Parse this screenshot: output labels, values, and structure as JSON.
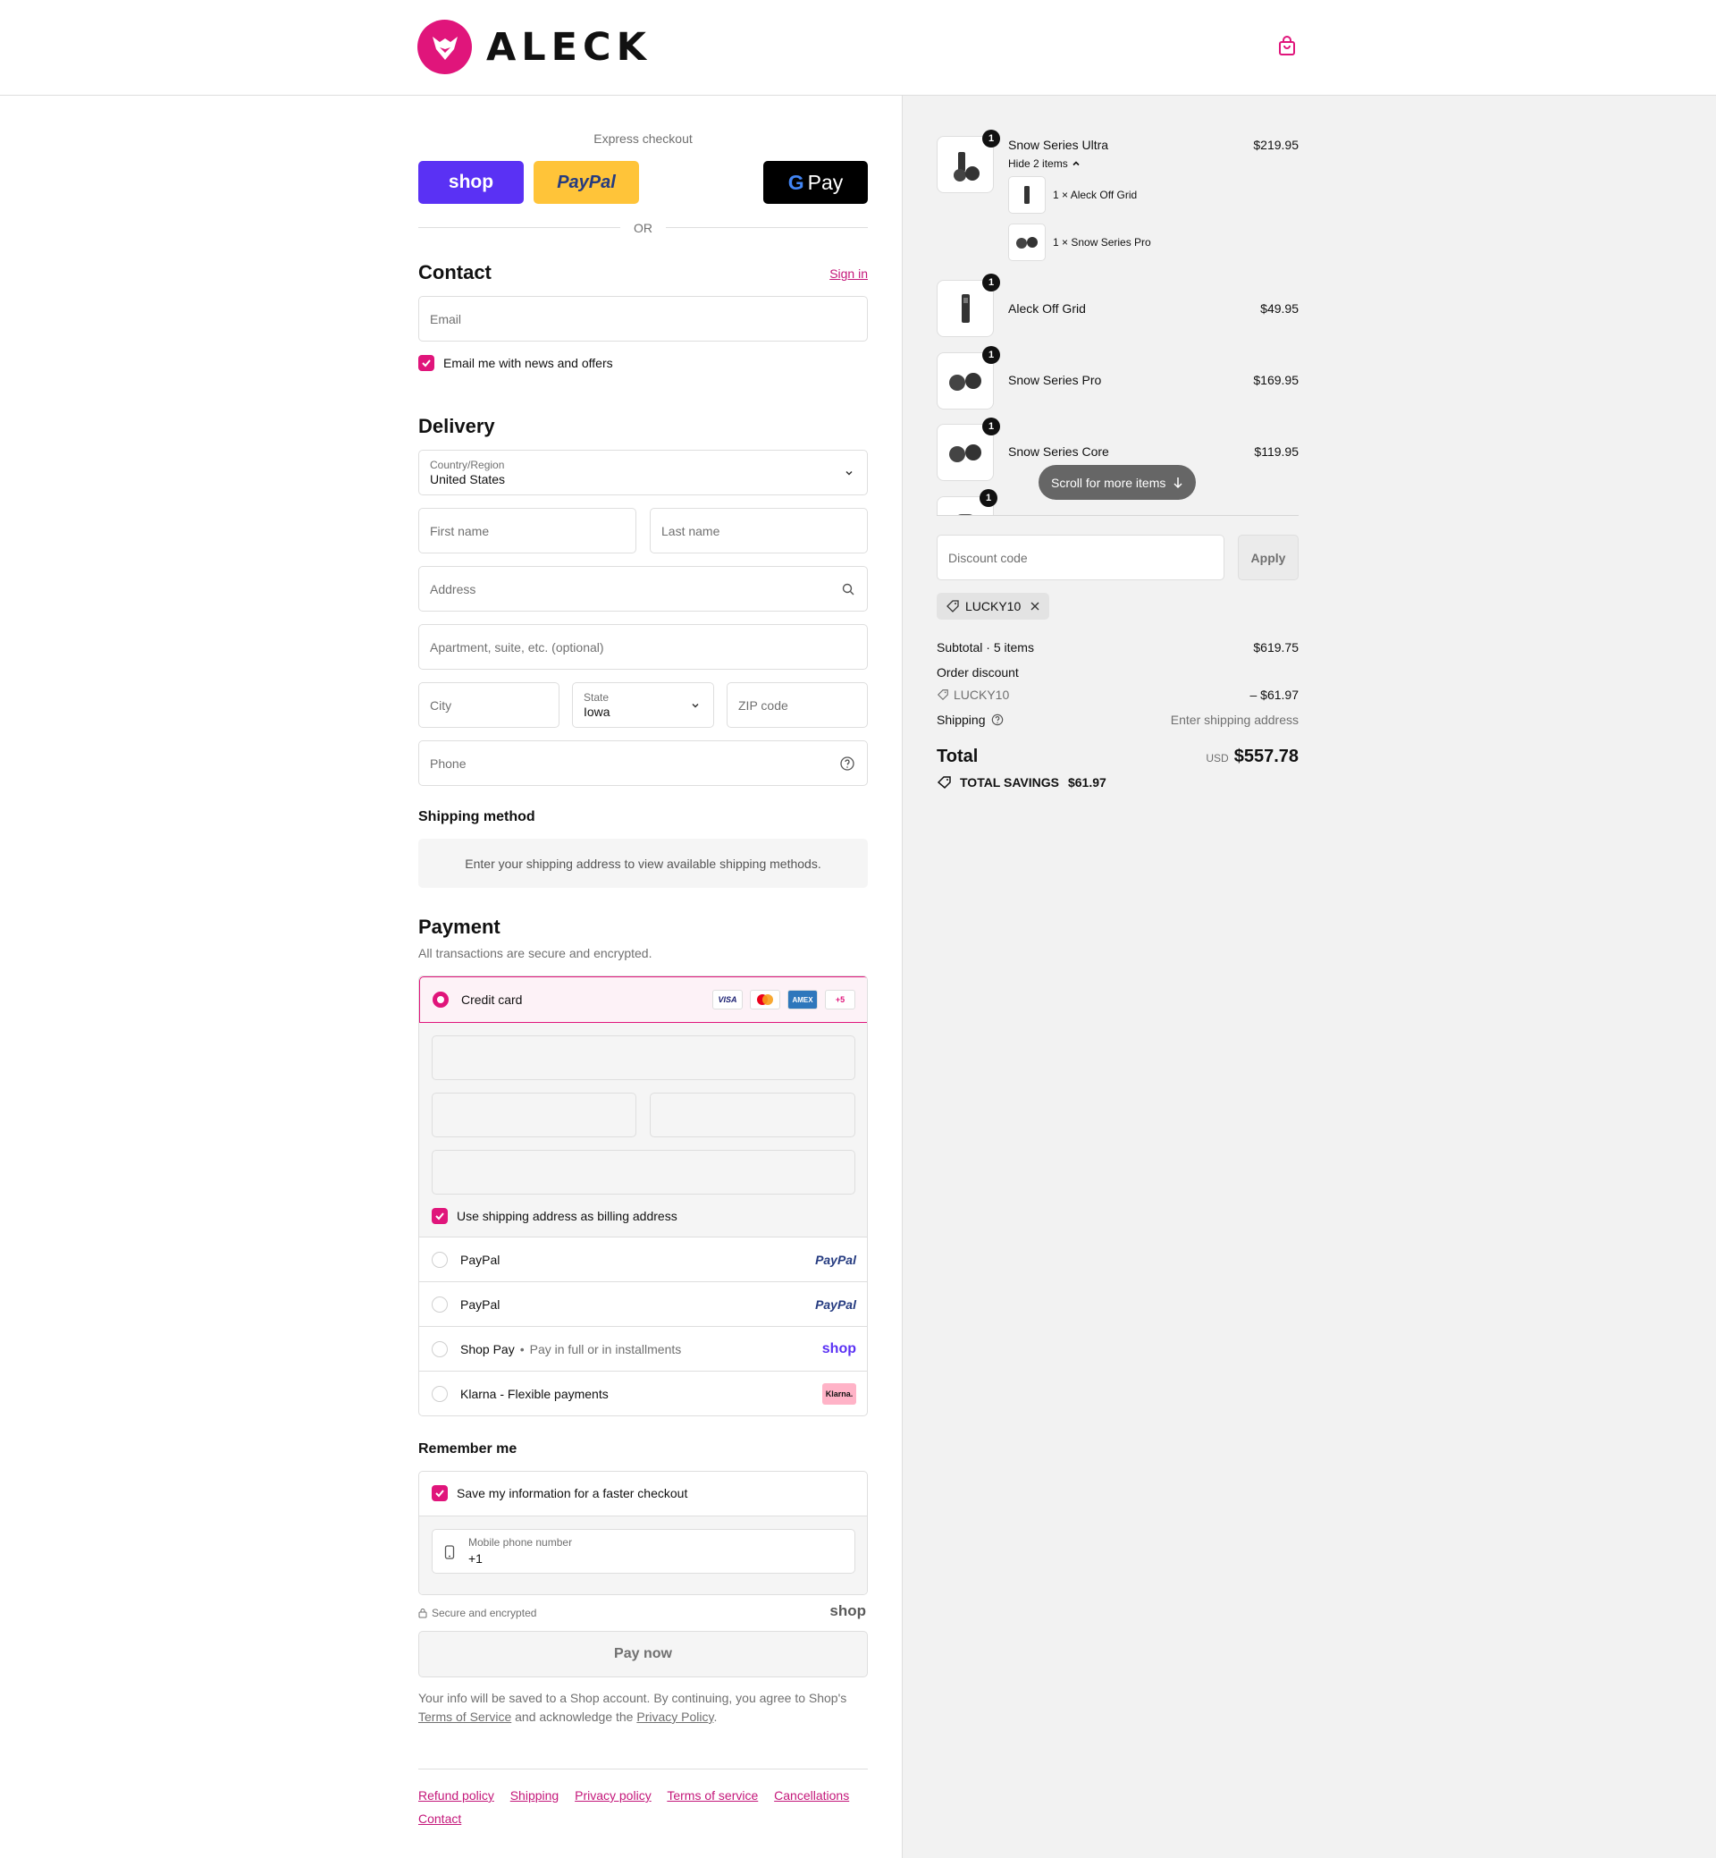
{
  "header": {
    "brand": "ALECK",
    "cart_icon": "shopping-bag-icon"
  },
  "colors": {
    "accent": "#e0157b",
    "shop_purple": "#5a31f4",
    "paypal_gold": "#ffc439"
  },
  "express": {
    "title": "Express checkout",
    "shop_label": "shop",
    "paypal_label": "PayPal",
    "gpay_label": "Pay",
    "or_label": "OR"
  },
  "contact": {
    "title": "Contact",
    "sign_in": "Sign in",
    "email_placeholder": "Email",
    "news_label": "Email me with news and offers"
  },
  "delivery": {
    "title": "Delivery",
    "country_label": "Country/Region",
    "country_value": "United States",
    "first_name": "First name",
    "last_name": "Last name",
    "address": "Address",
    "apartment": "Apartment, suite, etc. (optional)",
    "city": "City",
    "state_label": "State",
    "state_value": "Iowa",
    "zip": "ZIP code",
    "phone": "Phone"
  },
  "shipping": {
    "title": "Shipping method",
    "notice": "Enter your shipping address to view available shipping methods."
  },
  "payment": {
    "title": "Payment",
    "subtitle": "All transactions are secure and encrypted.",
    "credit_card": "Credit card",
    "cards": [
      "VISA",
      "MC",
      "AMEX",
      "+5"
    ],
    "billing_label": "Use shipping address as billing address",
    "methods": [
      {
        "label": "PayPal",
        "logo": "PayPal"
      },
      {
        "label": "PayPal",
        "logo": "PayPal"
      },
      {
        "label": "Shop Pay",
        "sub": "Pay in full or in installments",
        "logo": "shop"
      },
      {
        "label": "Klarna - Flexible payments",
        "logo": "Klarna."
      }
    ]
  },
  "remember": {
    "title": "Remember me",
    "save_label": "Save my information for a faster checkout",
    "mobile_label": "Mobile phone number",
    "mobile_value": "+1",
    "secure": "Secure and encrypted",
    "shop_logo": "shop"
  },
  "pay_now": "Pay now",
  "legal": {
    "text1": "Your info will be saved to a Shop account. By continuing, you agree to Shop's",
    "terms": "Terms of Service",
    "text2": "and acknowledge the",
    "privacy": "Privacy Policy",
    "end": "."
  },
  "footer": {
    "links": [
      "Refund policy",
      "Shipping",
      "Privacy policy",
      "Terms of service",
      "Cancellations"
    ],
    "contact": "Contact"
  },
  "order": {
    "items": [
      {
        "name": "Snow Series Ultra",
        "price": "$219.95",
        "qty": "1",
        "toggle": "Hide 2 items",
        "sub_items": [
          {
            "label": "1 × Aleck Off Grid"
          },
          {
            "label": "1 × Snow Series Pro"
          }
        ]
      },
      {
        "name": "Aleck Off Grid",
        "price": "$49.95",
        "qty": "1"
      },
      {
        "name": "Snow Series Pro",
        "price": "$169.95",
        "qty": "1"
      },
      {
        "name": "Snow Series Core",
        "price": "$119.95",
        "qty": "1"
      },
      {
        "qty": "1"
      }
    ],
    "scroll_hint": "Scroll for more items",
    "discount_placeholder": "Discount code",
    "apply": "Apply",
    "code_tag": "LUCKY10",
    "subtotal_label": "Subtotal · 5 items",
    "subtotal_value": "$619.75",
    "order_discount": "Order discount",
    "discount_code": "LUCKY10",
    "discount_value": "– $61.97",
    "shipping_label": "Shipping",
    "shipping_value": "Enter shipping address",
    "total_label": "Total",
    "currency": "USD",
    "total_value": "$557.78",
    "savings_label": "TOTAL SAVINGS",
    "savings_value": "$61.97"
  }
}
